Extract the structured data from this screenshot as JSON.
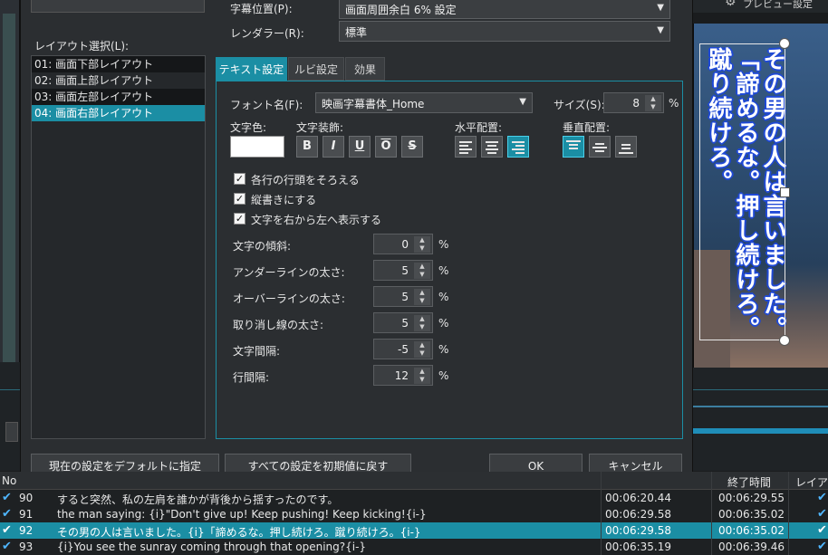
{
  "background": {
    "preview_settings_label": "プレビュー設定",
    "preview_subtitle": "その男の人は言いました。\n「諦めるな。押し続けろ。\n蹴り続けろ。"
  },
  "dialog": {
    "subtitle_position_label": "字幕位置(P):",
    "subtitle_position_value": "画面周囲余白 6% 設定",
    "renderer_label": "レンダラー(R):",
    "renderer_value": "標準",
    "layout_select_label": "レイアウト選択(L):",
    "layouts": [
      {
        "label": "01: 画面下部レイアウト"
      },
      {
        "label": "02: 画面上部レイアウト"
      },
      {
        "label": "03: 画面左部レイアウト"
      },
      {
        "label": "04: 画面右部レイアウト"
      }
    ],
    "tabs": [
      {
        "label": "テキスト設定"
      },
      {
        "label": "ルビ設定"
      },
      {
        "label": "効果"
      }
    ],
    "font_name_label": "フォント名(F):",
    "font_name_value": "映画字幕書体_Home",
    "size_label": "サイズ(S):",
    "size_value": "8",
    "size_unit": "%",
    "text_color_label": "文字色:",
    "text_decoration_label": "文字装飾:",
    "decoration_buttons": [
      "B",
      "I",
      "U",
      "O",
      "S"
    ],
    "h_align_label": "水平配置:",
    "v_align_label": "垂直配置:",
    "checkboxes": [
      {
        "label": "各行の行頭をそろえる",
        "checked": true
      },
      {
        "label": "縦書きにする",
        "checked": true
      },
      {
        "label": "文字を右から左へ表示する",
        "checked": true
      }
    ],
    "numeric_fields": [
      {
        "label": "文字の傾斜:",
        "value": "0",
        "unit": "%"
      },
      {
        "label": "アンダーラインの太さ:",
        "value": "5",
        "unit": "%"
      },
      {
        "label": "オーバーラインの太さ:",
        "value": "5",
        "unit": "%"
      },
      {
        "label": "取り消し線の太さ:",
        "value": "5",
        "unit": "%"
      },
      {
        "label": "文字間隔:",
        "value": "-5",
        "unit": "%"
      },
      {
        "label": "行間隔:",
        "value": "12",
        "unit": "%"
      }
    ],
    "buttons": {
      "set_default": "現在の設定をデフォルトに指定",
      "reset_all": "すべての設定を初期値に戻す",
      "ok": "OK",
      "cancel": "キャンセル"
    }
  },
  "table": {
    "headers": {
      "no": "No",
      "end_time": "終了時間",
      "layout": "レイアウ"
    },
    "rows": [
      {
        "no": "90",
        "text": "すると突然、私の左肩を誰かが背後から揺すったのです。",
        "start": "00:06:20.44",
        "end": "00:06:29.55",
        "checked": true
      },
      {
        "no": "91",
        "text": "the man saying: {i}\"Don't give up! Keep pushing! Keep kicking!{i-}",
        "start": "00:06:29.58",
        "end": "00:06:35.02",
        "checked": true
      },
      {
        "no": "92",
        "text": "その男の人は言いました。{i}「諦めるな。押し続けろ。蹴り続けろ。{i-}",
        "start": "00:06:29.58",
        "end": "00:06:35.02",
        "checked": true
      },
      {
        "no": "93",
        "text": "{i}You see the sunray coming through that opening?{i-}",
        "start": "00:06:35.19",
        "end": "00:06:39.46",
        "checked": true
      }
    ]
  }
}
